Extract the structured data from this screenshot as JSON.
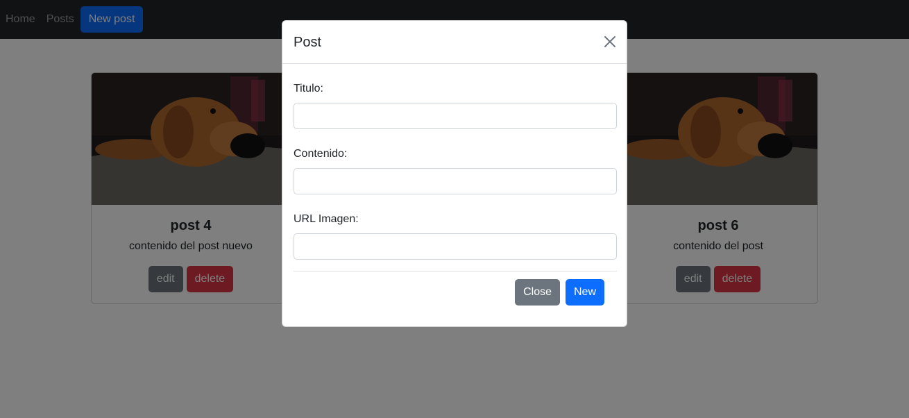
{
  "navbar": {
    "home": "Home",
    "posts": "Posts",
    "new_post": "New post"
  },
  "cards": [
    {
      "title": "post 4",
      "text": "contenido del post nuevo",
      "edit": "edit",
      "delete": "delete"
    },
    {
      "title": "post 6",
      "text": "contenido del post",
      "edit": "edit",
      "delete": "delete"
    }
  ],
  "modal": {
    "title": "Post",
    "close_icon": "close-icon",
    "fields": [
      {
        "label": "Titulo:",
        "value": "",
        "placeholder": ""
      },
      {
        "label": "Contenido:",
        "value": "",
        "placeholder": ""
      },
      {
        "label": "URL Imagen:",
        "value": "",
        "placeholder": ""
      }
    ],
    "close_button": "Close",
    "new_button": "New"
  },
  "colors": {
    "navbar_bg": "#212529",
    "primary": "#0d6efd",
    "secondary": "#6c757d",
    "danger": "#dc3545"
  }
}
